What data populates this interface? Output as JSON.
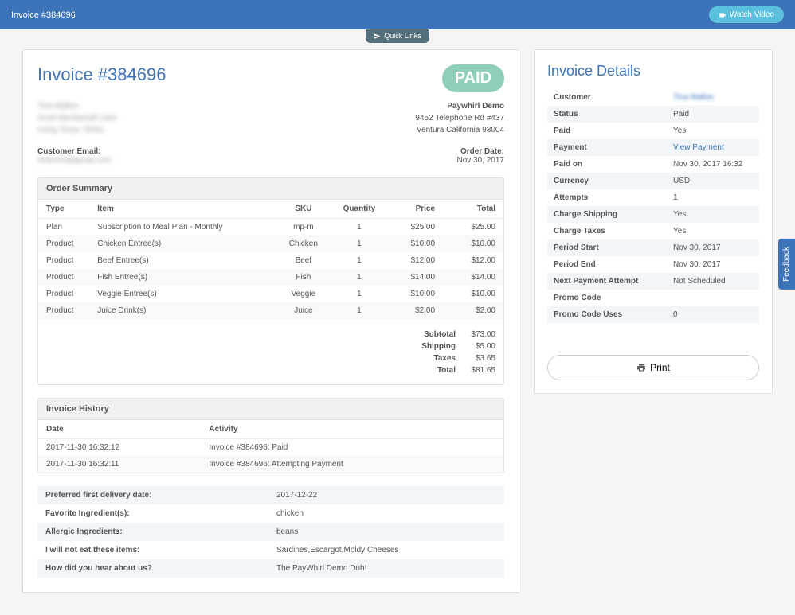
{
  "topbar": {
    "title": "Invoice #384696",
    "watch_video": "Watch Video",
    "quick_links": "Quick Links"
  },
  "invoice": {
    "title": "Invoice #384696",
    "paid_stamp": "PAID",
    "customer_name": "Tina Mallon",
    "customer_addr1": "Scott Mandamall Lane",
    "customer_addr2": "Irving Texas 75061",
    "company_name": "Paywhirl Demo",
    "company_addr1": "9452 Telephone Rd #437",
    "company_addr2": "Ventura California 93004",
    "customer_email_label": "Customer Email:",
    "customer_email": "tmancini@gmail.com",
    "order_date_label": "Order Date:",
    "order_date": "Nov 30, 2017"
  },
  "order_summary": {
    "heading": "Order Summary",
    "cols": {
      "type": "Type",
      "item": "Item",
      "sku": "SKU",
      "qty": "Quantity",
      "price": "Price",
      "total": "Total"
    },
    "rows": [
      {
        "type": "Plan",
        "item": "Subscription to Meal Plan - Monthly",
        "sku": "mp-m",
        "qty": "1",
        "price": "$25.00",
        "total": "$25.00"
      },
      {
        "type": "Product",
        "item": "Chicken Entree(s)",
        "sku": "Chicken",
        "qty": "1",
        "price": "$10.00",
        "total": "$10.00"
      },
      {
        "type": "Product",
        "item": "Beef Entree(s)",
        "sku": "Beef",
        "qty": "1",
        "price": "$12.00",
        "total": "$12.00"
      },
      {
        "type": "Product",
        "item": "Fish Entree(s)",
        "sku": "Fish",
        "qty": "1",
        "price": "$14.00",
        "total": "$14.00"
      },
      {
        "type": "Product",
        "item": "Veggie Entree(s)",
        "sku": "Veggie",
        "qty": "1",
        "price": "$10.00",
        "total": "$10.00"
      },
      {
        "type": "Product",
        "item": "Juice Drink(s)",
        "sku": "Juice",
        "qty": "1",
        "price": "$2.00",
        "total": "$2.00"
      }
    ],
    "totals": {
      "subtotal_l": "Subtotal",
      "subtotal_v": "$73.00",
      "shipping_l": "Shipping",
      "shipping_v": "$5.00",
      "taxes_l": "Taxes",
      "taxes_v": "$3.65",
      "total_l": "Total",
      "total_v": "$81.65"
    }
  },
  "history": {
    "heading": "Invoice History",
    "cols": {
      "date": "Date",
      "activity": "Activity"
    },
    "rows": [
      {
        "date": "2017-11-30 16:32:12",
        "activity": "Invoice #384696: Paid"
      },
      {
        "date": "2017-11-30 16:32:11",
        "activity": "Invoice #384696: Attempting Payment"
      }
    ]
  },
  "custom_fields": [
    {
      "label": "Preferred first delivery date:",
      "value": "2017-12-22"
    },
    {
      "label": "Favorite Ingredient(s):",
      "value": "chicken"
    },
    {
      "label": "Allergic Ingredients:",
      "value": "beans"
    },
    {
      "label": "I will not eat these items:",
      "value": "Sardines,Escargot,Moldy Cheeses"
    },
    {
      "label": "How did you hear about us?",
      "value": "The PayWhirl Demo Duh!"
    }
  ],
  "details": {
    "title": "Invoice Details",
    "rows": [
      {
        "label": "Customer",
        "value": "Tina Mallon",
        "link": true,
        "blurred": true
      },
      {
        "label": "Status",
        "value": "Paid"
      },
      {
        "label": "Paid",
        "value": "Yes"
      },
      {
        "label": "Payment",
        "value": "View Payment",
        "link": true
      },
      {
        "label": "Paid on",
        "value": "Nov 30, 2017 16:32"
      },
      {
        "label": "Currency",
        "value": "USD"
      },
      {
        "label": "Attempts",
        "value": "1"
      },
      {
        "label": "Charge Shipping",
        "value": "Yes"
      },
      {
        "label": "Charge Taxes",
        "value": "Yes"
      },
      {
        "label": "Period Start",
        "value": "Nov 30, 2017"
      },
      {
        "label": "Period End",
        "value": "Nov 30, 2017"
      },
      {
        "label": "Next Payment Attempt",
        "value": "Not Scheduled"
      },
      {
        "label": "Promo Code",
        "value": ""
      },
      {
        "label": "Promo Code Uses",
        "value": "0"
      }
    ],
    "print": "Print"
  },
  "feedback": "Feedback"
}
